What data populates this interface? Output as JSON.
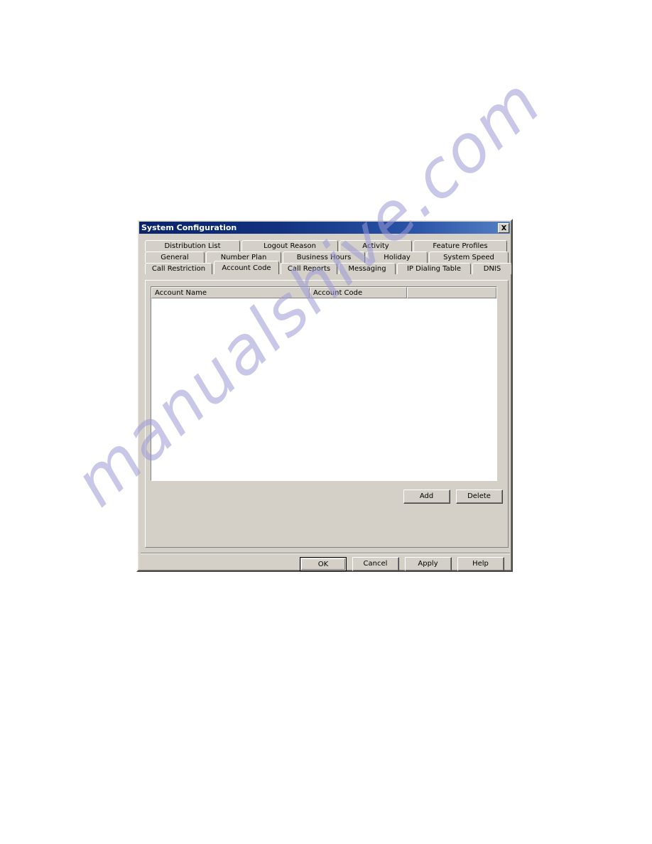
{
  "window": {
    "title": "System Configuration",
    "close_icon": "close-icon",
    "close_label": "Close"
  },
  "tabs": {
    "rows": [
      [
        {
          "label": "Distribution List",
          "selected": false
        },
        {
          "label": "Logout Reason",
          "selected": false
        },
        {
          "label": "Activity",
          "selected": false
        },
        {
          "label": "Feature Profiles",
          "selected": false
        }
      ],
      [
        {
          "label": "General",
          "selected": false
        },
        {
          "label": "Number Plan",
          "selected": false
        },
        {
          "label": "Business Hours",
          "selected": false
        },
        {
          "label": "Holiday",
          "selected": false
        },
        {
          "label": "System Speed",
          "selected": false
        }
      ],
      [
        {
          "label": "Call Restriction",
          "selected": false
        },
        {
          "label": "Account Code",
          "selected": true
        },
        {
          "label": "Call Reports",
          "selected": false
        },
        {
          "label": "Messaging",
          "selected": false
        },
        {
          "label": "IP Dialing Table",
          "selected": false
        },
        {
          "label": "DNIS",
          "selected": false
        }
      ]
    ],
    "active_tab": "Account Code"
  },
  "account_code_page": {
    "list": {
      "columns": [
        "Account Name",
        "Account Code",
        ""
      ],
      "rows": []
    },
    "add_label": "Add",
    "delete_label": "Delete"
  },
  "footer": {
    "ok_label": "OK",
    "cancel_label": "Cancel",
    "apply_label": "Apply",
    "help_label": "Help",
    "default_button": "OK"
  },
  "watermark": {
    "text": "manualshive.com",
    "color": "#9d9ad6"
  },
  "colors": {
    "dialog_face": "#d4d0c8",
    "titlebar_start": "#0a246a",
    "titlebar_end": "#5580c4",
    "list_background": "#ffffff",
    "page_background": "#ffffff"
  }
}
